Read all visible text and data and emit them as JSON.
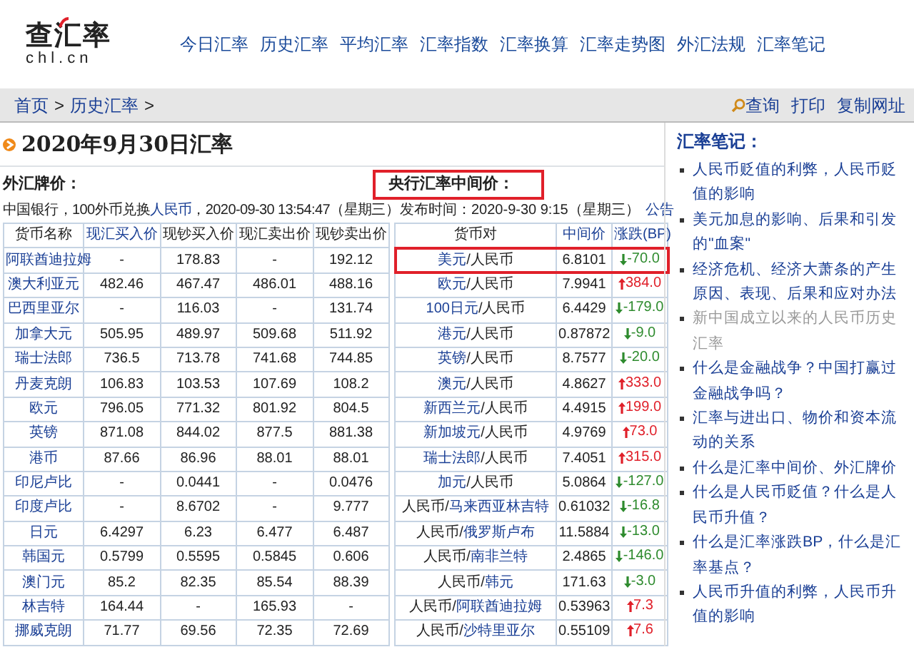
{
  "logo": {
    "text": "查汇率",
    "domain": "chl.cn"
  },
  "nav": [
    "今日汇率",
    "历史汇率",
    "平均汇率",
    "汇率指数",
    "汇率换算",
    "汇率走势图",
    "外汇法规",
    "汇率笔记"
  ],
  "breadcrumb": [
    {
      "text": "首页",
      "link": true
    },
    {
      "text": ">",
      "link": false
    },
    {
      "text": "历史汇率",
      "link": true
    },
    {
      "text": ">",
      "link": false
    }
  ],
  "tools": [
    {
      "label": "查询",
      "kind": "search"
    },
    {
      "label": "打印",
      "kind": "plain"
    },
    {
      "label": "复制网址",
      "kind": "plain"
    }
  ],
  "page_title": "2020年9月30日汇率",
  "boc": {
    "heading": "外汇牌价：",
    "note_before": "中国银行，100外币兑换",
    "note_link": "人民币",
    "note_after": "，2020-09-30 13:54:47（星期三）",
    "columns": [
      {
        "label": "货币名称",
        "link": false
      },
      {
        "label": "现汇买入价",
        "link": true
      },
      {
        "label": "现钞买入价",
        "link": false
      },
      {
        "label": "现汇卖出价",
        "link": false
      },
      {
        "label": "现钞卖出价",
        "link": false
      }
    ],
    "rows": [
      [
        "阿联酋迪拉姆",
        "-",
        "178.83",
        "-",
        "192.12"
      ],
      [
        "澳大利亚元",
        "482.46",
        "467.47",
        "486.01",
        "488.16"
      ],
      [
        "巴西里亚尔",
        "-",
        "116.03",
        "-",
        "131.74"
      ],
      [
        "加拿大元",
        "505.95",
        "489.97",
        "509.68",
        "511.92"
      ],
      [
        "瑞士法郎",
        "736.5",
        "713.78",
        "741.68",
        "744.85"
      ],
      [
        "丹麦克朗",
        "106.83",
        "103.53",
        "107.69",
        "108.2"
      ],
      [
        "欧元",
        "796.05",
        "771.32",
        "801.92",
        "804.5"
      ],
      [
        "英镑",
        "871.08",
        "844.02",
        "877.5",
        "881.38"
      ],
      [
        "港币",
        "87.66",
        "86.96",
        "88.01",
        "88.01"
      ],
      [
        "印尼卢比",
        "-",
        "0.0441",
        "-",
        "0.0476"
      ],
      [
        "印度卢比",
        "-",
        "8.6702",
        "-",
        "9.777"
      ],
      [
        "日元",
        "6.4297",
        "6.23",
        "6.477",
        "6.487"
      ],
      [
        "韩国元",
        "0.5799",
        "0.5595",
        "0.5845",
        "0.606"
      ],
      [
        "澳门元",
        "85.2",
        "82.35",
        "85.54",
        "88.39"
      ],
      [
        "林吉特",
        "164.44",
        "-",
        "165.93",
        "-"
      ],
      [
        "挪威克朗",
        "71.77",
        "69.56",
        "72.35",
        "72.69"
      ]
    ]
  },
  "central": {
    "heading": "央行汇率中间价：",
    "heading_highlighted": true,
    "release": "发布时间：2020-9-30 9:15（星期三）",
    "notice": "公告",
    "columns": [
      {
        "label": "货币对",
        "link": false
      },
      {
        "label": "中间价",
        "link": true
      },
      {
        "label": "涨跌(BP)",
        "link": true
      }
    ],
    "rows": [
      {
        "pair": [
          {
            "text": "美元",
            "link": true
          },
          {
            "text": "/人民币",
            "link": false
          }
        ],
        "mid": "6.8101",
        "change": "-70.0",
        "rising": false,
        "highlighted": true
      },
      {
        "pair": [
          {
            "text": "欧元",
            "link": true
          },
          {
            "text": "/人民币",
            "link": false
          }
        ],
        "mid": "7.9941",
        "change": "384.0",
        "rising": true,
        "highlighted": false
      },
      {
        "pair": [
          {
            "text": "100日元",
            "link": true
          },
          {
            "text": "/人民币",
            "link": false
          }
        ],
        "mid": "6.4429",
        "change": "-179.0",
        "rising": false,
        "highlighted": false
      },
      {
        "pair": [
          {
            "text": "港元",
            "link": true
          },
          {
            "text": "/人民币",
            "link": false
          }
        ],
        "mid": "0.87872",
        "change": "-9.0",
        "rising": false,
        "highlighted": false
      },
      {
        "pair": [
          {
            "text": "英镑",
            "link": true
          },
          {
            "text": "/人民币",
            "link": false
          }
        ],
        "mid": "8.7577",
        "change": "-20.0",
        "rising": false,
        "highlighted": false
      },
      {
        "pair": [
          {
            "text": "澳元",
            "link": true
          },
          {
            "text": "/人民币",
            "link": false
          }
        ],
        "mid": "4.8627",
        "change": "333.0",
        "rising": true,
        "highlighted": false
      },
      {
        "pair": [
          {
            "text": "新西兰元",
            "link": true
          },
          {
            "text": "/人民币",
            "link": false
          }
        ],
        "mid": "4.4915",
        "change": "199.0",
        "rising": true,
        "highlighted": false
      },
      {
        "pair": [
          {
            "text": "新加坡元",
            "link": true
          },
          {
            "text": "/人民币",
            "link": false
          }
        ],
        "mid": "4.9769",
        "change": "73.0",
        "rising": true,
        "highlighted": false
      },
      {
        "pair": [
          {
            "text": "瑞士法郎",
            "link": true
          },
          {
            "text": "/人民币",
            "link": false
          }
        ],
        "mid": "7.4051",
        "change": "315.0",
        "rising": true,
        "highlighted": false
      },
      {
        "pair": [
          {
            "text": "加元",
            "link": true
          },
          {
            "text": "/人民币",
            "link": false
          }
        ],
        "mid": "5.0864",
        "change": "-127.0",
        "rising": false,
        "highlighted": false
      },
      {
        "pair": [
          {
            "text": "人民币/",
            "link": false
          },
          {
            "text": "马来西亚林吉特",
            "link": true
          }
        ],
        "mid": "0.61032",
        "change": "-16.8",
        "rising": false,
        "highlighted": false
      },
      {
        "pair": [
          {
            "text": "人民币/",
            "link": false
          },
          {
            "text": "俄罗斯卢布",
            "link": true
          }
        ],
        "mid": "11.5884",
        "change": "-13.0",
        "rising": false,
        "highlighted": false
      },
      {
        "pair": [
          {
            "text": "人民币/",
            "link": false
          },
          {
            "text": "南非兰特",
            "link": true
          }
        ],
        "mid": "2.4865",
        "change": "-146.0",
        "rising": false,
        "highlighted": false
      },
      {
        "pair": [
          {
            "text": "人民币/",
            "link": false
          },
          {
            "text": "韩元",
            "link": true
          }
        ],
        "mid": "171.63",
        "change": "-3.0",
        "rising": false,
        "highlighted": false
      },
      {
        "pair": [
          {
            "text": "人民币/",
            "link": false
          },
          {
            "text": "阿联酋迪拉姆",
            "link": true
          }
        ],
        "mid": "0.53963",
        "change": "7.3",
        "rising": true,
        "highlighted": false
      },
      {
        "pair": [
          {
            "text": "人民币/",
            "link": false
          },
          {
            "text": "沙特里亚尔",
            "link": true
          }
        ],
        "mid": "0.55109",
        "change": "7.6",
        "rising": true,
        "highlighted": false
      }
    ]
  },
  "notes": {
    "title": "汇率笔记：",
    "items": [
      {
        "text": "人民币贬值的利弊，人民币贬值的影响",
        "visited": false
      },
      {
        "text": "美元加息的影响、后果和引发的\"血案\"",
        "visited": false
      },
      {
        "text": "经济危机、经济大萧条的产生原因、表现、后果和应对办法",
        "visited": false
      },
      {
        "text": "新中国成立以来的人民币历史汇率",
        "visited": true
      },
      {
        "text": "什么是金融战争？中国打赢过金融战争吗？",
        "visited": false
      },
      {
        "text": "汇率与进出口、物价和资本流动的关系",
        "visited": false
      },
      {
        "text": "什么是汇率中间价、外汇牌价",
        "visited": false
      },
      {
        "text": "什么是人民币贬值？什么是人民币升值？",
        "visited": false
      },
      {
        "text": "什么是汇率涨跌BP，什么是汇率基点？",
        "visited": false
      },
      {
        "text": "人民币升值的利弊，人民币升值的影响",
        "visited": false
      }
    ]
  }
}
